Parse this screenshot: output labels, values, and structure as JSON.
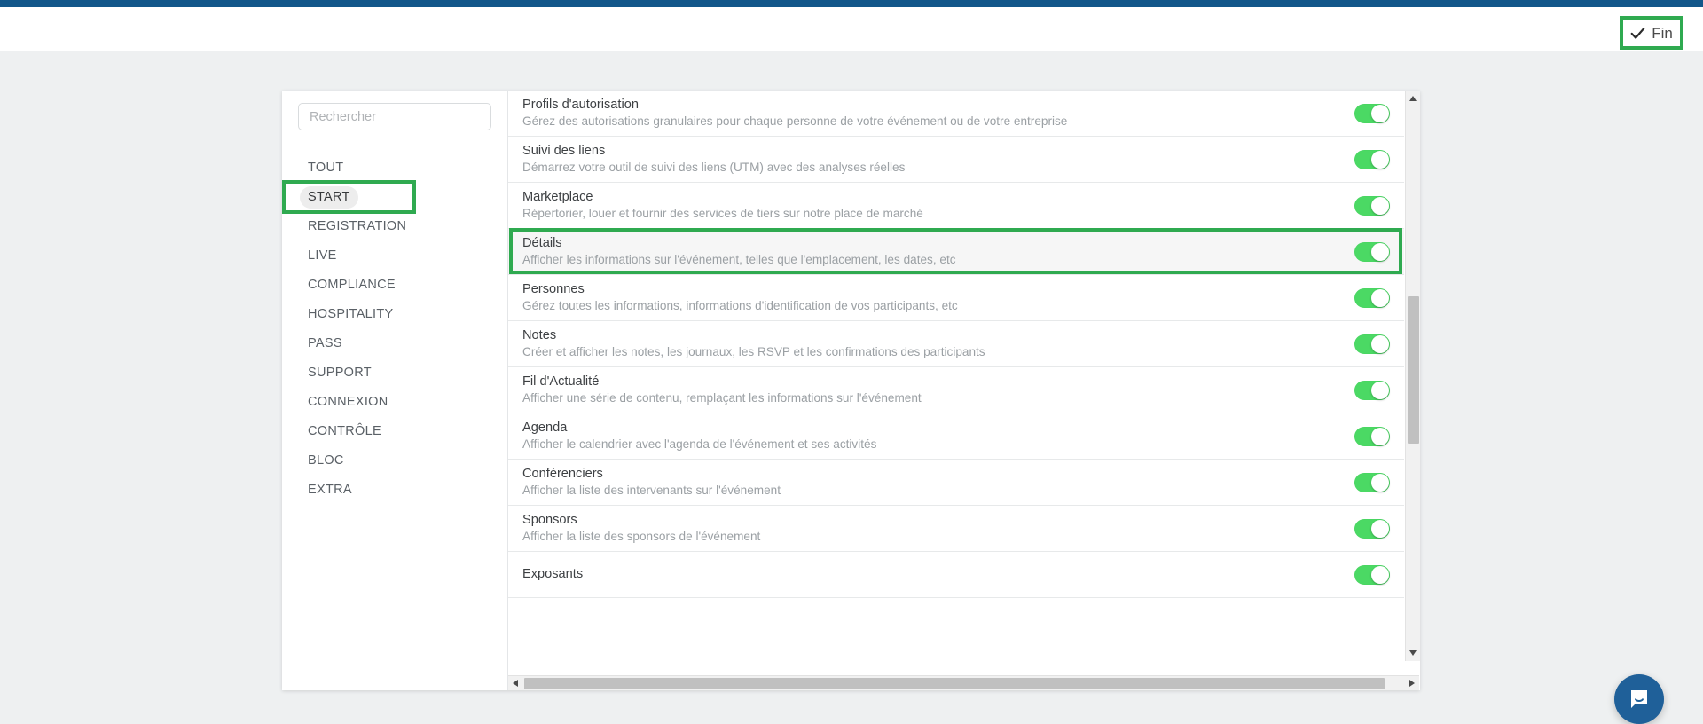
{
  "header": {
    "finish_button": {
      "label": "Fin",
      "icon": "check-icon",
      "highlight_color": "#2faa50"
    },
    "top_strip_color": "#12578a"
  },
  "sidebar": {
    "search": {
      "placeholder": "Rechercher",
      "value": ""
    },
    "items": [
      {
        "label": "TOUT",
        "active": false,
        "highlighted": false
      },
      {
        "label": "START",
        "active": true,
        "highlighted": true
      },
      {
        "label": "REGISTRATION",
        "active": false,
        "highlighted": false
      },
      {
        "label": "LIVE",
        "active": false,
        "highlighted": false
      },
      {
        "label": "COMPLIANCE",
        "active": false,
        "highlighted": false
      },
      {
        "label": "HOSPITALITY",
        "active": false,
        "highlighted": false
      },
      {
        "label": "PASS",
        "active": false,
        "highlighted": false
      },
      {
        "label": "SUPPORT",
        "active": false,
        "highlighted": false
      },
      {
        "label": "CONNEXION",
        "active": false,
        "highlighted": false
      },
      {
        "label": "CONTRÔLE",
        "active": false,
        "highlighted": false
      },
      {
        "label": "BLOC",
        "active": false,
        "highlighted": false
      },
      {
        "label": "EXTRA",
        "active": false,
        "highlighted": false
      }
    ]
  },
  "feature_list": {
    "rows": [
      {
        "title": "Profils d'autorisation",
        "description": "Gérez des autorisations granulaires pour chaque personne de votre événement ou de votre entreprise",
        "toggle": "on",
        "highlighted": false
      },
      {
        "title": "Suivi des liens",
        "description": "Démarrez votre outil de suivi des liens (UTM) avec des analyses réelles",
        "toggle": "on",
        "highlighted": false
      },
      {
        "title": "Marketplace",
        "description": "Répertorier, louer et fournir des services de tiers sur notre place de marché",
        "toggle": "on",
        "highlighted": false
      },
      {
        "title": "Détails",
        "description": "Afficher les informations sur l'événement, telles que l'emplacement, les dates, etc",
        "toggle": "on",
        "highlighted": true
      },
      {
        "title": "Personnes",
        "description": "Gérez toutes les informations, informations d'identification de vos participants, etc",
        "toggle": "on",
        "highlighted": false
      },
      {
        "title": "Notes",
        "description": "Créer et afficher les notes, les journaux, les RSVP et les confirmations des participants",
        "toggle": "on",
        "highlighted": false
      },
      {
        "title": "Fil d'Actualité",
        "description": "Afficher une série de contenu, remplaçant les informations sur l'événement",
        "toggle": "on",
        "highlighted": false
      },
      {
        "title": "Agenda",
        "description": "Afficher le calendrier avec l'agenda de l'événement et ses activités",
        "toggle": "on",
        "highlighted": false
      },
      {
        "title": "Conférenciers",
        "description": "Afficher la liste des intervenants sur l'événement",
        "toggle": "on",
        "highlighted": false
      },
      {
        "title": "Sponsors",
        "description": "Afficher la liste des sponsors de l'événement",
        "toggle": "on",
        "highlighted": false
      },
      {
        "title": "Exposants",
        "description": "",
        "toggle": "on",
        "highlighted": false
      }
    ],
    "toggle_on_color": "#4bd964"
  },
  "chat_launcher": {
    "icon": "chat-bubble-icon",
    "color": "#1f6099"
  }
}
